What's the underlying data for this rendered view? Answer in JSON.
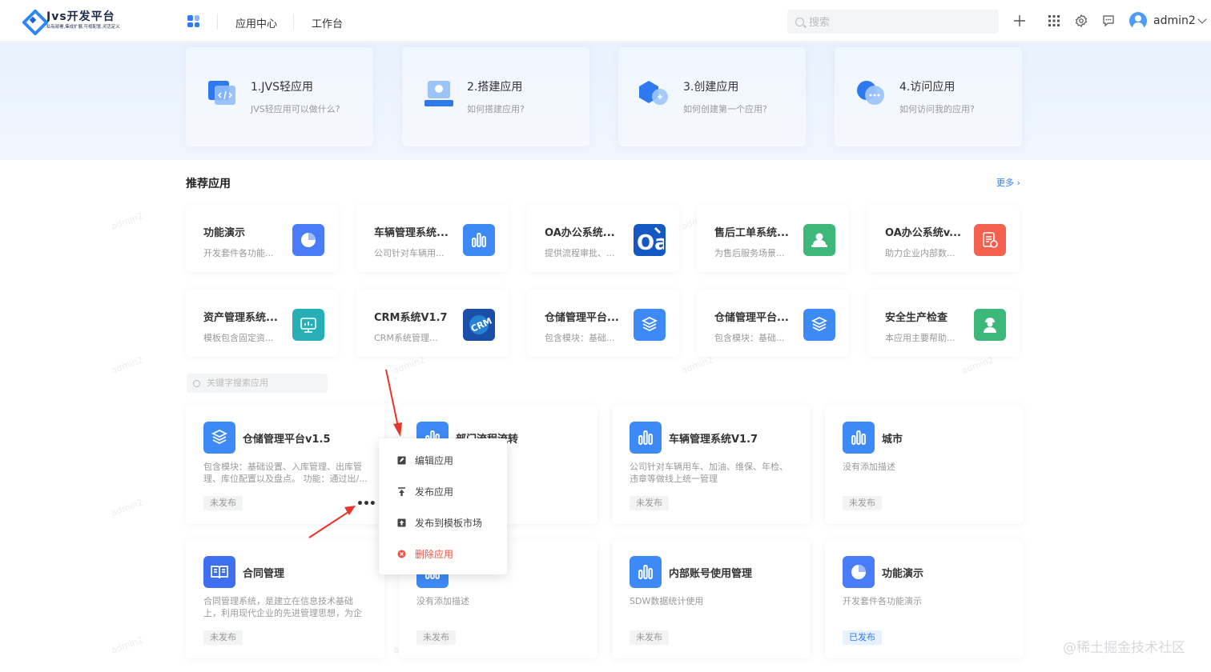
{
  "header": {
    "logo_title": "Jvs开发平台",
    "logo_subtitle": "私有部署,集成扩展,可视配置,灵活定义",
    "nav": [
      "应用中心",
      "工作台"
    ],
    "search_placeholder": "搜索",
    "username": "admin2",
    "icons": [
      "plus-icon",
      "apps-grid-icon",
      "gear-icon",
      "message-icon"
    ]
  },
  "guides": [
    {
      "title": "1.JVS轻应用",
      "desc": "JVS轻应用可以做什么?",
      "icon": "code-window-icon"
    },
    {
      "title": "2.搭建应用",
      "desc": "如何搭建应用?",
      "icon": "build-app-icon"
    },
    {
      "title": "3.创建应用",
      "desc": "如何创建第一个应用?",
      "icon": "create-app-icon"
    },
    {
      "title": "4.访问应用",
      "desc": "如何访问我的应用?",
      "icon": "chat-bubble-icon"
    }
  ],
  "recommended": {
    "title": "推荐应用",
    "more": "更多",
    "apps": [
      {
        "title": "功能演示",
        "desc": "开发套件各功能...",
        "icon": "pie-chart-icon",
        "color": "#4a7cf7"
      },
      {
        "title": "车辆管理系统...",
        "desc": "公司针对车辆用...",
        "icon": "bar-chart-icon",
        "color": "#3d8af7"
      },
      {
        "title": "OA办公系统...",
        "desc": "提供流程审批、...",
        "icon": "oa-icon",
        "color": "#1458c4"
      },
      {
        "title": "售后工单系统...",
        "desc": "为售后服务场景...",
        "icon": "person-icon",
        "color": "#3cb87a"
      },
      {
        "title": "OA办公系统v...",
        "desc": "助力企业内部数...",
        "icon": "document-icon",
        "color": "#f5614f"
      },
      {
        "title": "资产管理系统...",
        "desc": "模板包含固定资...",
        "icon": "monitor-icon",
        "color": "#26b0b5"
      },
      {
        "title": "CRM系统V1.7",
        "desc": "CRM系统管理帮...",
        "icon": "crm-icon",
        "color": "#2a6fd6"
      },
      {
        "title": "仓储管理平台...",
        "desc": "包含模块：基础...",
        "icon": "box-icon",
        "color": "#3d8af7"
      },
      {
        "title": "仓储管理平台...",
        "desc": "包含模块：基础...",
        "icon": "box-icon",
        "color": "#3d8af7"
      },
      {
        "title": "安全生产检查",
        "desc": "本应用主要帮助...",
        "icon": "worker-icon",
        "color": "#3cb87a"
      }
    ]
  },
  "keyword_search_placeholder": "关键字搜索应用",
  "my_apps": [
    {
      "title": "仓储管理平台v1.5",
      "desc": "包含模块：基础设置、入库管理、出库管理、库位配置以及盘点。 功能：通过出/...",
      "status": "未发布",
      "icon": "box-icon",
      "color": "#3d8af7"
    },
    {
      "title": "部门流程流转",
      "desc": "",
      "status": "",
      "icon": "bar-chart-icon",
      "color": "#3d8af7"
    },
    {
      "title": "车辆管理系统V1.7",
      "desc": "公司针对车辆用车、加油、维保、年检、违章等做线上统一管理",
      "status": "未发布",
      "icon": "bar-chart-icon",
      "color": "#3d8af7"
    },
    {
      "title": "城市",
      "desc": "没有添加描述",
      "status": "未发布",
      "icon": "bar-chart-icon",
      "color": "#3d8af7"
    },
    {
      "title": "合同管理",
      "desc": "合同管理系统，是建立在信息技术基础上，利用现代企业的先进管理思想，为企业提...",
      "status": "未发布",
      "icon": "book-icon",
      "color": "#3d6ff0"
    },
    {
      "title": "",
      "desc": "没有添加描述",
      "status": "未发布",
      "icon": "bar-chart-icon",
      "color": "#3d8af7"
    },
    {
      "title": "内部账号使用管理",
      "desc": "SDW数据统计使用",
      "status": "未发布",
      "icon": "bar-chart-icon",
      "color": "#3d8af7"
    },
    {
      "title": "功能演示",
      "desc": "开发套件各功能演示",
      "status": "已发布",
      "icon": "pie-chart-icon",
      "color": "#4a7cf7"
    }
  ],
  "context_menu": {
    "items": [
      {
        "label": "编辑应用",
        "icon": "edit-icon"
      },
      {
        "label": "发布应用",
        "icon": "publish-icon"
      },
      {
        "label": "发布到模板市场",
        "icon": "upload-template-icon"
      },
      {
        "label": "删除应用",
        "icon": "delete-icon"
      }
    ],
    "danger_color": "#f2503f"
  },
  "more_button": "•••",
  "watermark_text": "admin2",
  "site_watermark": "@稀土掘金技术社区",
  "colors": {
    "accent": "#2f7df6",
    "banner_bg": "#e8f1fd",
    "annotation_arrow": "#e8342a"
  }
}
